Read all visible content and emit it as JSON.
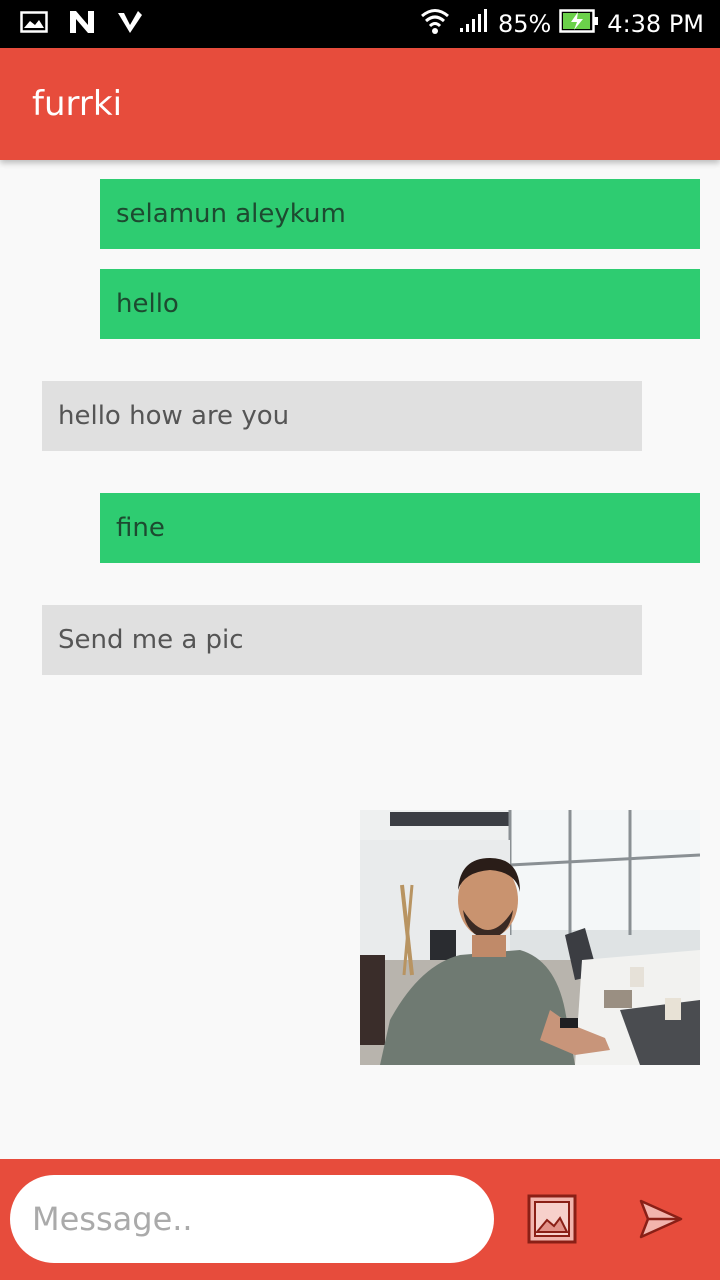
{
  "status_bar": {
    "battery": "85%",
    "time": "4:38 PM"
  },
  "app_bar": {
    "title": "furrki"
  },
  "messages": [
    {
      "text": "selamun aleykum",
      "direction": "sent"
    },
    {
      "text": "hello",
      "direction": "sent"
    },
    {
      "text": "hello how are you",
      "direction": "received"
    },
    {
      "text": "fine",
      "direction": "sent"
    },
    {
      "text": "Send me a pic",
      "direction": "received"
    }
  ],
  "input": {
    "placeholder": "Message.."
  },
  "icons": {
    "status_left": [
      "gallery-notification-icon",
      "n-notification-icon",
      "v-notification-icon"
    ],
    "status_right": [
      "wifi-icon",
      "signal-icon",
      "battery-charging-icon"
    ],
    "bottom": [
      "image-attach-icon",
      "send-icon"
    ]
  },
  "colors": {
    "primary": "#e74c3c",
    "sent_bubble": "#2ecc71",
    "received_bubble": "#e0e0e0"
  }
}
